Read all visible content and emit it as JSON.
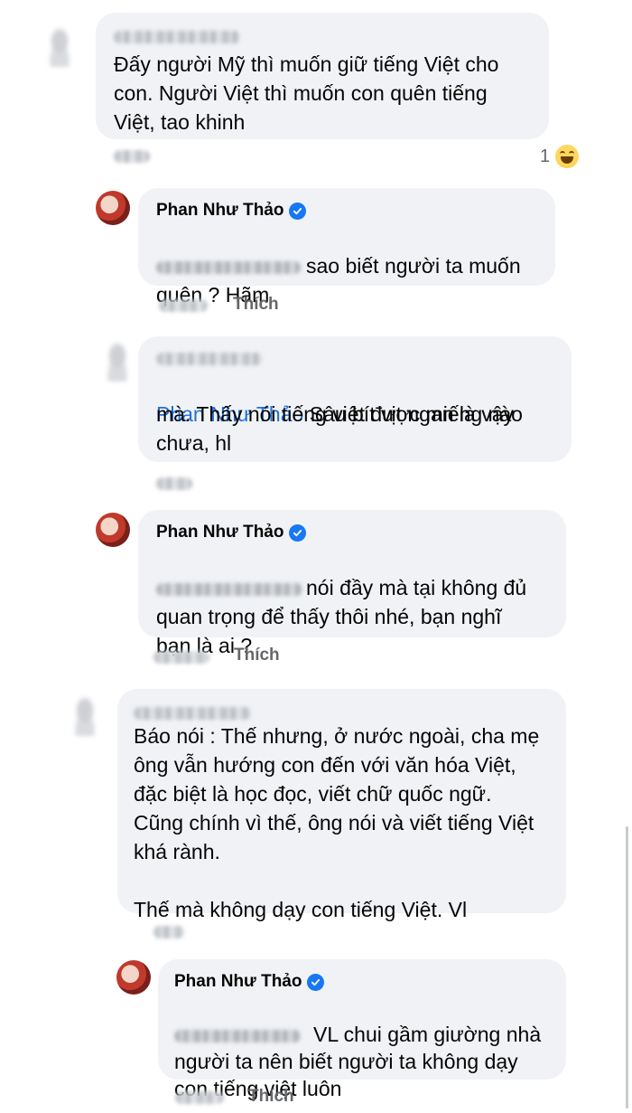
{
  "comments": [
    {
      "id": "c1",
      "author": "",
      "text": "Đấy người Mỹ thì muốn giữ tiếng Việt cho\ncon. Người Việt thì muốn con quên tiếng\nViệt, tao khinh",
      "reaction": {
        "count": "1",
        "icon": "haha-emoji-icon"
      }
    },
    {
      "id": "r1",
      "author": "Phan Như Thảo",
      "verified": true,
      "text_line1": "sao biết người ta muốn",
      "text_rest": "quên ? Hãm",
      "like_label": "Thích"
    },
    {
      "id": "c2",
      "author": "",
      "mention": "Phan Như Thảo",
      "text_line1": "Sâu bít vịt ngan là vậy",
      "text_rest": "mà. Thấy nói tiếng việt được miếng nào\nchưa, hl"
    },
    {
      "id": "r2",
      "author": "Phan Như Thảo",
      "verified": true,
      "text_line1": "nói đầy mà tại không đủ",
      "text_rest": "quan trọng để thấy thôi nhé, bạn nghĩ\nbạn là ai ?",
      "like_label": "Thích"
    },
    {
      "id": "c3",
      "author": "",
      "text": "Báo nói : Thế nhưng, ở nước ngoài, cha mẹ\nông vẫn hướng con đến với văn hóa Việt,\nđặc biệt là học đọc, viết chữ quốc ngữ.\nCũng chính vì thế, ông nói và viết tiếng Việt\nkhá rành.\n\nThế mà không dạy con tiếng Việt. Vl"
    },
    {
      "id": "r3",
      "author": "Phan Như Thảo",
      "verified": true,
      "text_line1": "VL chui gầm giường nhà",
      "text_rest": "người ta nên biết người ta không dạy\ncon tiếng việt luôn",
      "like_label": "Thích"
    }
  ],
  "colors": {
    "bubble": "#f0f2f5",
    "text": "#050505",
    "meta": "#65676b",
    "link": "#216fdb",
    "verified": "#1877f2"
  }
}
